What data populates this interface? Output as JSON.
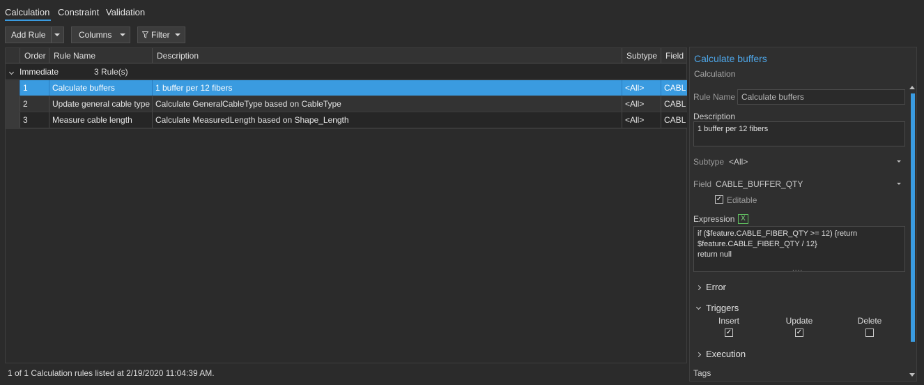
{
  "tabs": [
    {
      "label": "Calculation",
      "active": true
    },
    {
      "label": "Constraint",
      "active": false
    },
    {
      "label": "Validation",
      "active": false
    }
  ],
  "toolbar": {
    "add_rule_label": "Add Rule",
    "columns_label": "Columns",
    "filter_label": "Filter"
  },
  "grid": {
    "columns": [
      "Order",
      "Rule Name",
      "Description",
      "Subtype",
      "Field"
    ],
    "group": {
      "name": "Immediate",
      "count": "3 Rule(s)"
    },
    "rows": [
      {
        "order": "1",
        "name": "Calculate buffers",
        "description": "1 buffer per 12 fibers",
        "subtype": "<All>",
        "field": "CABL"
      },
      {
        "order": "2",
        "name": "Update general cable type",
        "description": "Calculate GeneralCableType based on CableType",
        "subtype": "<All>",
        "field": "CABL"
      },
      {
        "order": "3",
        "name": "Measure cable length",
        "description": "Calculate MeasuredLength based on Shape_Length",
        "subtype": "<All>",
        "field": "CABL"
      }
    ]
  },
  "status_text": "1 of 1 Calculation rules listed at 2/19/2020 11:04:39 AM.",
  "panel": {
    "title": "Calculate buffers",
    "subtitle": "Calculation",
    "rule_name_label": "Rule Name",
    "rule_name_value": "Calculate buffers",
    "description_label": "Description",
    "description_value": "1 buffer per 12 fibers",
    "subtype_label": "Subtype",
    "subtype_value": "<All>",
    "field_label": "Field",
    "field_value": "CABLE_BUFFER_QTY",
    "editable_label": "Editable",
    "editable_checked": true,
    "expression_label": "Expression",
    "expression_value": "if ($feature.CABLE_FIBER_QTY >= 12) {return\n$feature.CABLE_FIBER_QTY / 12}\nreturn null",
    "error_label": "Error",
    "triggers_label": "Triggers",
    "triggers": [
      {
        "label": "Insert",
        "checked": true
      },
      {
        "label": "Update",
        "checked": true
      },
      {
        "label": "Delete",
        "checked": false
      }
    ],
    "execution_label": "Execution",
    "tags_label": "Tags"
  },
  "colors": {
    "accent": "#3a9be0",
    "title": "#4ea6e8",
    "background": "#2b2b2b"
  }
}
